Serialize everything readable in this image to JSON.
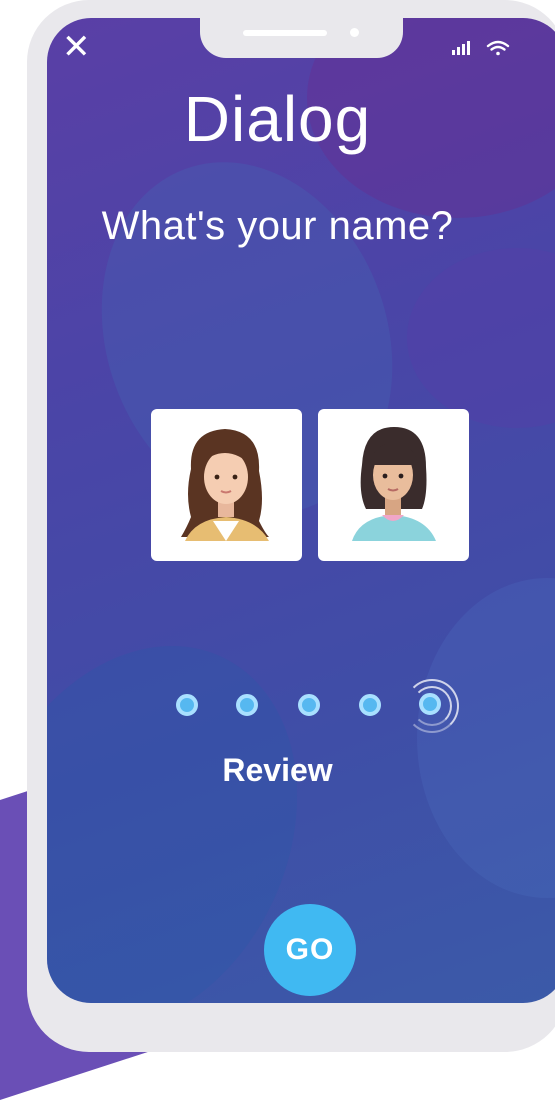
{
  "app": {
    "title": "Dialog",
    "question": "What's your name?"
  },
  "top_bar": {
    "close_icon": "close-icon",
    "signal_icon": "signal-icon",
    "wifi_icon": "wifi-icon"
  },
  "avatars": [
    {
      "name": "avatar-curly-hair",
      "icon": "female-avatar-curly"
    },
    {
      "name": "avatar-bob-hair",
      "icon": "female-avatar-bob"
    }
  ],
  "progress": {
    "total_steps": 5,
    "current_step": 5,
    "label": "Review"
  },
  "actions": {
    "go_label": "GO"
  },
  "colors": {
    "accent": "#40b9f2",
    "screen_top": "#5a3fa6",
    "screen_bottom": "#3b5aa8",
    "phone_frame": "#e9e8ec"
  }
}
